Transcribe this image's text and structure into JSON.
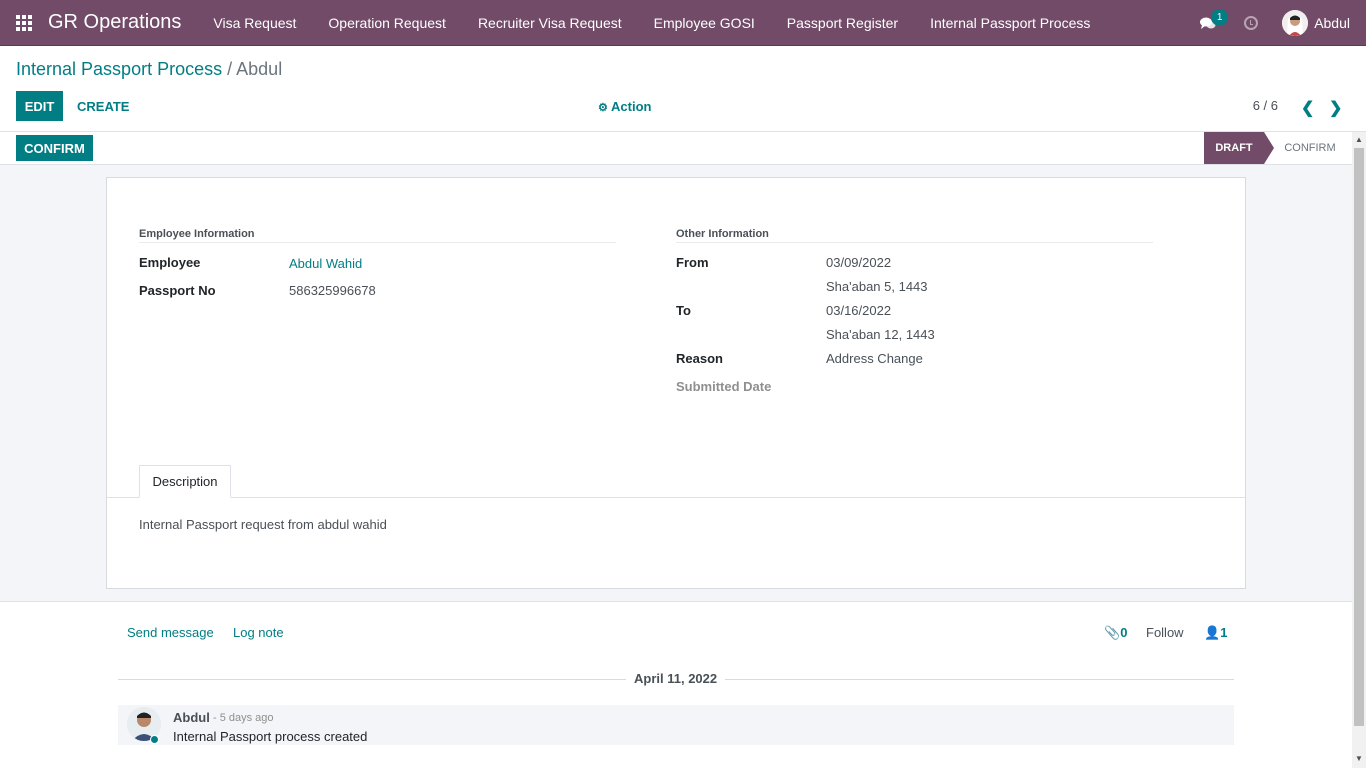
{
  "navbar": {
    "app_title": "GR Operations",
    "menu": [
      "Visa Request",
      "Operation Request",
      "Recruiter Visa Request",
      "Employee GOSI",
      "Passport Register",
      "Internal Passport Process"
    ],
    "messages_count": "1",
    "user_name": "Abdul"
  },
  "breadcrumb": {
    "parent": "Internal Passport Process",
    "separator": "/",
    "current": "Abdul"
  },
  "toolbar": {
    "edit": "EDIT",
    "create": "CREATE",
    "action": "Action",
    "pager": "6 / 6"
  },
  "statusbar": {
    "confirm_button": "CONFIRM",
    "stages": [
      "DRAFT",
      "CONFIRM"
    ],
    "active_stage": "DRAFT"
  },
  "form": {
    "employee_info": {
      "title": "Employee Information",
      "employee_label": "Employee",
      "employee_value": "Abdul Wahid",
      "passport_label": "Passport No",
      "passport_value": "586325996678"
    },
    "other_info": {
      "title": "Other Information",
      "from_label": "From",
      "from_value": "03/09/2022",
      "from_hijri": "Sha'aban 5, 1443",
      "to_label": "To",
      "to_value": "03/16/2022",
      "to_hijri": "Sha'aban 12, 1443",
      "reason_label": "Reason",
      "reason_value": "Address Change",
      "submitted_label": "Submitted Date",
      "submitted_value": ""
    },
    "tabs": [
      {
        "label": "Description"
      }
    ],
    "description": "Internal Passport request from abdul wahid"
  },
  "chatter": {
    "send_message": "Send message",
    "log_note": "Log note",
    "attachments": "0",
    "follow": "Follow",
    "followers": "1",
    "date_separator": "April 11, 2022",
    "messages": [
      {
        "author": "Abdul",
        "time": "- 5 days ago",
        "body": "Internal Passport process created"
      }
    ]
  }
}
